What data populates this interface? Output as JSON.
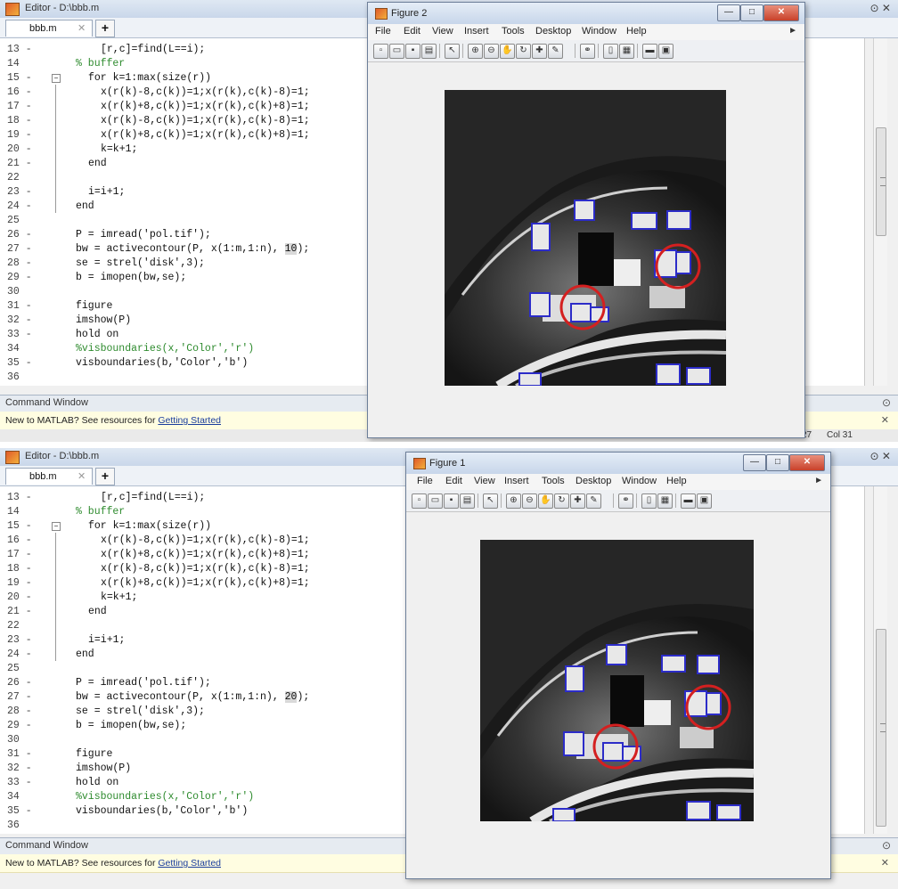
{
  "windows": [
    {
      "editor": {
        "title": "Editor - D:\\bbb.m",
        "tab_label": "bbb.m",
        "tab_close": "✕",
        "tab_add": "+",
        "window_controls": "⊙ ✕",
        "lines": [
          {
            "num": "13 -",
            "code": "[r,c]=find(L==i);",
            "indent": 5
          },
          {
            "num": "14",
            "code": "% buffer",
            "indent": 1,
            "comment": true
          },
          {
            "num": "15 -",
            "code": "for k=1:max(size(r))",
            "indent": 3
          },
          {
            "num": "16 -",
            "code": "x(r(k)-8,c(k))=1;x(r(k),c(k)-8)=1;",
            "indent": 5
          },
          {
            "num": "17 -",
            "code": "x(r(k)+8,c(k))=1;x(r(k),c(k)+8)=1;",
            "indent": 5
          },
          {
            "num": "18 -",
            "code": "x(r(k)-8,c(k))=1;x(r(k),c(k)-8)=1;",
            "indent": 5
          },
          {
            "num": "19 -",
            "code": "x(r(k)+8,c(k))=1;x(r(k),c(k)+8)=1;",
            "indent": 5
          },
          {
            "num": "20 -",
            "code": "k=k+1;",
            "indent": 5
          },
          {
            "num": "21 -",
            "code": "end",
            "indent": 3
          },
          {
            "num": "22",
            "code": "",
            "indent": 0
          },
          {
            "num": "23 -",
            "code": "i=i+1;",
            "indent": 3
          },
          {
            "num": "24 -",
            "code": "end",
            "indent": 1
          },
          {
            "num": "25",
            "code": "",
            "indent": 0
          },
          {
            "num": "26 -",
            "code": "P = imread('pol.tif');",
            "indent": 1
          },
          {
            "num": "27 -",
            "code": "bw = activecontour(P, x(1:m,1:n),",
            "indent": 1,
            "highlight": "10",
            "after": ");"
          },
          {
            "num": "28 -",
            "code": "se = strel('disk',3);",
            "indent": 1
          },
          {
            "num": "29 -",
            "code": "b = imopen(bw,se);",
            "indent": 1
          },
          {
            "num": "30",
            "code": "",
            "indent": 0
          },
          {
            "num": "31 -",
            "code": "figure",
            "indent": 1
          },
          {
            "num": "32 -",
            "code": "imshow(P)",
            "indent": 1
          },
          {
            "num": "33 -",
            "code": "hold on",
            "indent": 1
          },
          {
            "num": "34",
            "code": "%visboundaries(x,'Color','r')",
            "indent": 1,
            "comment": true
          },
          {
            "num": "35 -",
            "code": "visboundaries(b,'Color','b')",
            "indent": 1
          },
          {
            "num": "36",
            "code": "",
            "indent": 0
          }
        ],
        "command_window_label": "Command Window",
        "command_window_ctl": "⊙",
        "info_text": "New to MATLAB? See resources for ",
        "info_link": "Getting Started",
        "info_close": "✕",
        "status": "27",
        "status_col": "Col 31"
      },
      "figure": {
        "title": "Figure 2",
        "menu": [
          "File",
          "Edit",
          "View",
          "Insert",
          "Tools",
          "Desktop",
          "Window",
          "Help"
        ],
        "controls": {
          "minimize": "—",
          "maximize": "□",
          "close": "✕"
        }
      }
    },
    {
      "editor": {
        "title": "Editor - D:\\bbb.m",
        "tab_label": "bbb.m",
        "tab_close": "✕",
        "tab_add": "+",
        "window_controls": "⊙ ✕",
        "lines": [
          {
            "num": "13 -",
            "code": "[r,c]=find(L==i);",
            "indent": 5
          },
          {
            "num": "14",
            "code": "% buffer",
            "indent": 1,
            "comment": true
          },
          {
            "num": "15 -",
            "code": "for k=1:max(size(r))",
            "indent": 3
          },
          {
            "num": "16 -",
            "code": "x(r(k)-8,c(k))=1;x(r(k),c(k)-8)=1;",
            "indent": 5
          },
          {
            "num": "17 -",
            "code": "x(r(k)+8,c(k))=1;x(r(k),c(k)+8)=1;",
            "indent": 5
          },
          {
            "num": "18 -",
            "code": "x(r(k)-8,c(k))=1;x(r(k),c(k)-8)=1;",
            "indent": 5
          },
          {
            "num": "19 -",
            "code": "x(r(k)+8,c(k))=1;x(r(k),c(k)+8)=1;",
            "indent": 5
          },
          {
            "num": "20 -",
            "code": "k=k+1;",
            "indent": 5
          },
          {
            "num": "21 -",
            "code": "end",
            "indent": 3
          },
          {
            "num": "22",
            "code": "",
            "indent": 0
          },
          {
            "num": "23 -",
            "code": "i=i+1;",
            "indent": 3
          },
          {
            "num": "24 -",
            "code": "end",
            "indent": 1
          },
          {
            "num": "25",
            "code": "",
            "indent": 0
          },
          {
            "num": "26 -",
            "code": "P = imread('pol.tif');",
            "indent": 1
          },
          {
            "num": "27 -",
            "code": "bw = activecontour(P, x(1:m,1:n),",
            "indent": 1,
            "highlight": "20",
            "after": ");"
          },
          {
            "num": "28 -",
            "code": "se = strel('disk',3);",
            "indent": 1
          },
          {
            "num": "29 -",
            "code": "b = imopen(bw,se);",
            "indent": 1
          },
          {
            "num": "30",
            "code": "",
            "indent": 0
          },
          {
            "num": "31 -",
            "code": "figure",
            "indent": 1
          },
          {
            "num": "32 -",
            "code": "imshow(P)",
            "indent": 1
          },
          {
            "num": "33 -",
            "code": "hold on",
            "indent": 1
          },
          {
            "num": "34",
            "code": "%visboundaries(x,'Color','r')",
            "indent": 1,
            "comment": true
          },
          {
            "num": "35 -",
            "code": "visboundaries(b,'Color','b')",
            "indent": 1
          },
          {
            "num": "36",
            "code": "",
            "indent": 0
          }
        ],
        "command_window_label": "Command Window",
        "command_window_ctl": "⊙",
        "info_text": "New to MATLAB? See resources for ",
        "info_link": "Getting Started",
        "info_close": "✕",
        "status": "",
        "status_col": ""
      },
      "figure": {
        "title": "Figure 1",
        "menu": [
          "File",
          "Edit",
          "View",
          "Insert",
          "Tools",
          "Desktop",
          "Window",
          "Help"
        ],
        "controls": {
          "minimize": "—",
          "maximize": "□",
          "close": "✕"
        }
      }
    }
  ],
  "toolbar_icons": [
    "new-file-icon",
    "open-folder-icon",
    "save-icon",
    "print-icon",
    "pointer-icon",
    "zoom-in-icon",
    "zoom-out-icon",
    "pan-icon",
    "rotate-3d-icon",
    "data-cursor-icon",
    "brush-icon",
    "link-icon",
    "colorbar-icon",
    "legend-icon",
    "hide-plot-tools-icon",
    "show-plot-tools-icon"
  ],
  "colors": {
    "boundary": "#2c2cc8",
    "circle": "#d42020",
    "comment": "#2e8b2e",
    "link": "#1a3d9c"
  }
}
